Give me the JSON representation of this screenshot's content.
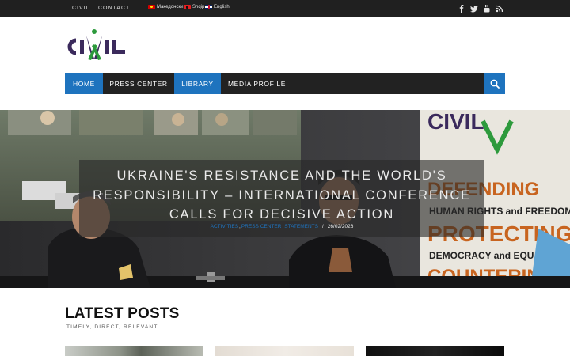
{
  "topbar": {
    "links": [
      "CIVIL",
      "CONTACT"
    ],
    "languages": [
      {
        "label": "Македонски",
        "flag": "mk-flag-icon"
      },
      {
        "label": "Shqip",
        "flag": "al-flag-icon"
      },
      {
        "label": "English",
        "flag": "gb-flag-icon"
      }
    ],
    "social_icons": [
      "facebook-icon",
      "twitter-icon",
      "youtube-icon",
      "rss-icon"
    ]
  },
  "logo": {
    "text": "CIVIL"
  },
  "nav": {
    "items": [
      "HOME",
      "PRESS CENTER",
      "LIBRARY",
      "MEDIA PROFILE"
    ],
    "active": [
      "HOME",
      "LIBRARY"
    ],
    "search_icon": "search-icon"
  },
  "hero": {
    "title": "UKRAINE'S RESISTANCE AND THE WORLD'S RESPONSIBILITY – INTERNATIONAL CONFERENCE CALLS FOR DECISIVE ACTION",
    "categories": [
      "ACTIVITIES",
      "PRESS CENTER",
      "STATEMENTS"
    ],
    "date": "26/02/2026"
  },
  "latest": {
    "title": "LATEST POSTS",
    "subtitle": "TIMELY, DIRECT, RELEVANT"
  },
  "colors": {
    "accent": "#1e73be",
    "topbar": "#202020",
    "nav": "#222222",
    "logo_purple": "#3b2a5c",
    "logo_green": "#2d9a3c"
  }
}
